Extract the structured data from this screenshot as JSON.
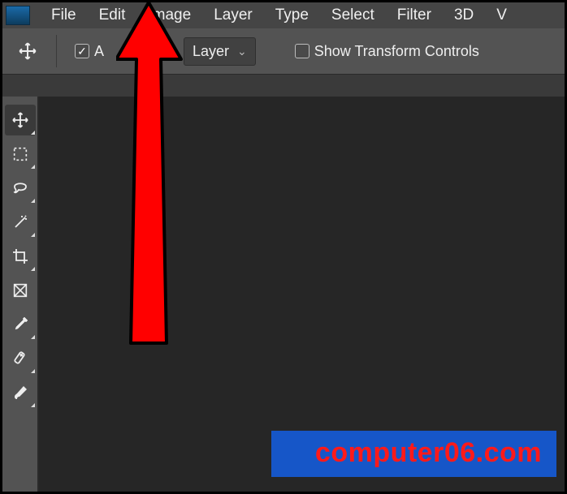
{
  "menubar": {
    "items": [
      "File",
      "Edit",
      "Image",
      "Layer",
      "Type",
      "Select",
      "Filter",
      "3D",
      "V"
    ]
  },
  "optionsbar": {
    "auto_select_checked": true,
    "auto_select_label_fragment": "A",
    "layer_dropdown": "Layer",
    "show_transform_checked": false,
    "show_transform_label": "Show Transform Controls"
  },
  "tools": [
    {
      "name": "move-tool",
      "active": true
    },
    {
      "name": "marquee-tool",
      "active": false
    },
    {
      "name": "lasso-tool",
      "active": false
    },
    {
      "name": "magic-wand-tool",
      "active": false
    },
    {
      "name": "crop-tool",
      "active": false
    },
    {
      "name": "frame-tool",
      "active": false
    },
    {
      "name": "eyedropper-tool",
      "active": false
    },
    {
      "name": "healing-brush-tool",
      "active": false
    },
    {
      "name": "brush-tool",
      "active": false
    }
  ],
  "watermark": "computer06.com"
}
